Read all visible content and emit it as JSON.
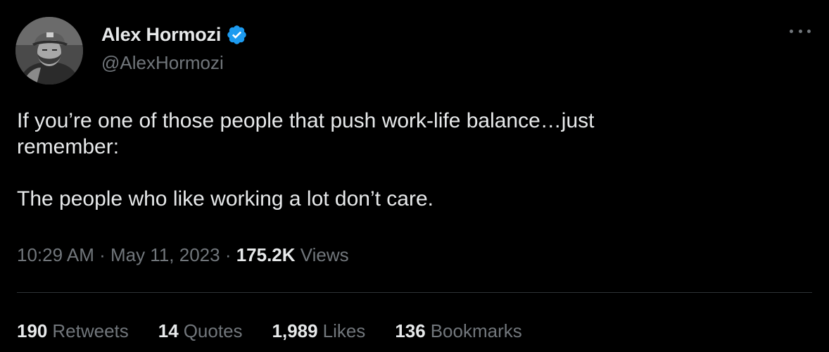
{
  "colors": {
    "background": "#000000",
    "text_primary": "#e7e9ea",
    "text_secondary": "#71767b",
    "verified_badge": "#1d9bf0",
    "divider": "#2f3336"
  },
  "author": {
    "display_name": "Alex Hormozi",
    "handle": "@AlexHormozi",
    "verified_icon": "verified-badge-icon"
  },
  "tweet": {
    "lines": [
      "If you’re one of those people that push work-life balance…just",
      "remember:",
      "The people who like working a lot don’t care."
    ]
  },
  "meta": {
    "time": "10:29 AM",
    "separator1": " · ",
    "date": "May 11, 2023",
    "separator2": " · ",
    "views_count": "175.2K",
    "views_label": " Views"
  },
  "stats": [
    {
      "count": "190",
      "label": "Retweets"
    },
    {
      "count": "14",
      "label": "Quotes"
    },
    {
      "count": "1,989",
      "label": "Likes"
    },
    {
      "count": "136",
      "label": "Bookmarks"
    }
  ]
}
